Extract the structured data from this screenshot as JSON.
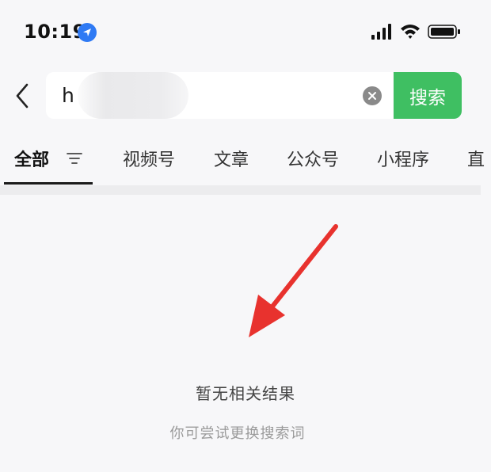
{
  "status_bar": {
    "time": "10:19"
  },
  "search": {
    "query": "h",
    "button_label": "搜索"
  },
  "tabs": [
    {
      "label": "全部",
      "active": true
    },
    {
      "label": "视频号",
      "active": false
    },
    {
      "label": "文章",
      "active": false
    },
    {
      "label": "公众号",
      "active": false
    },
    {
      "label": "小程序",
      "active": false
    },
    {
      "label": "直",
      "active": false
    }
  ],
  "empty_state": {
    "title": "暂无相关结果",
    "subtitle": "你可尝试更换搜索词"
  },
  "colors": {
    "search_button": "#3fbf62",
    "annotation_arrow": "#e8322e",
    "location_badge": "#2f7af4"
  }
}
